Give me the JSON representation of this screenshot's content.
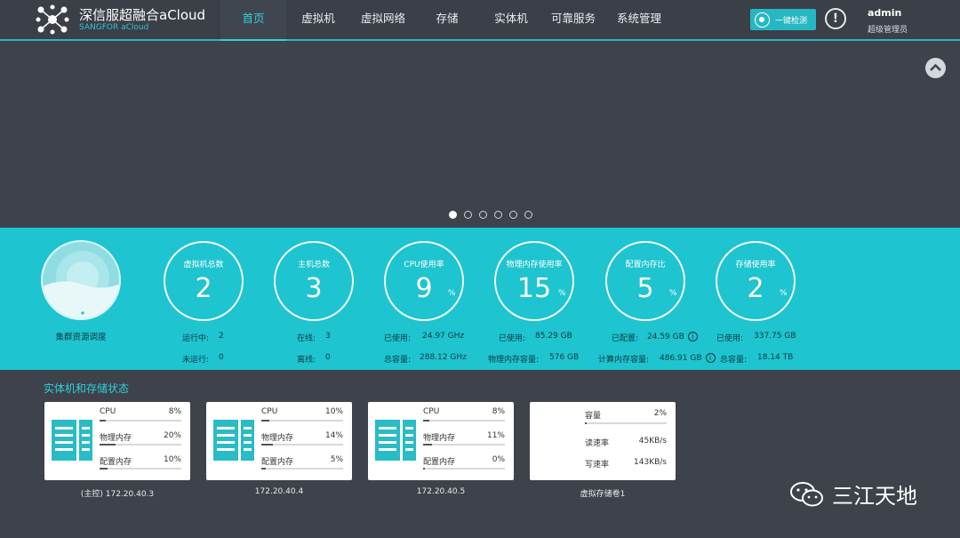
{
  "header": {
    "brand": "深信服超融合aCloud",
    "brand_sub": "SANGFOR aCloud",
    "nav": [
      "首页",
      "虚拟机",
      "虚拟网络",
      "存储",
      "实体机",
      "可靠服务",
      "系统管理"
    ],
    "check_button": "一键检测",
    "alert": "!",
    "user_name": "admin",
    "user_role": "超级管理员"
  },
  "overview": {
    "cluster_label": "集群资源调度",
    "rings": [
      {
        "title": "虚拟机总数",
        "value": "2",
        "pct": ""
      },
      {
        "title": "主机总数",
        "value": "3",
        "pct": ""
      },
      {
        "title": "CPU使用率",
        "value": "9",
        "pct": "%"
      },
      {
        "title": "物理内存使用率",
        "value": "15",
        "pct": "%"
      },
      {
        "title": "配置内存比",
        "value": "5",
        "pct": "%"
      },
      {
        "title": "存储使用率",
        "value": "2",
        "pct": "%"
      }
    ],
    "stats": [
      [
        {
          "label": "运行中:",
          "value": "2"
        },
        {
          "label": "未运行:",
          "value": "0"
        }
      ],
      [
        {
          "label": "在线:",
          "value": "3"
        },
        {
          "label": "离线:",
          "value": "0"
        }
      ],
      [
        {
          "label": "已使用:",
          "value": "24.97 GHz"
        },
        {
          "label": "总容量:",
          "value": "288.12 GHz"
        }
      ],
      [
        {
          "label": "已使用:",
          "value": "85.29 GB"
        },
        {
          "label": "物理内存容量:",
          "value": "576 GB"
        }
      ],
      [
        {
          "label": "已配置:",
          "value": "24.59 GB"
        },
        {
          "label": "计算内存容量:",
          "value": "486.91 GB"
        }
      ],
      [
        {
          "label": "已使用:",
          "value": "337.75 GB"
        },
        {
          "label": "总容量:",
          "value": "18.14 TB"
        }
      ]
    ]
  },
  "section_title": "实体机和存储状态",
  "hosts": [
    {
      "caption": "(主控) 172.20.40.3",
      "rows": [
        {
          "label": "CPU",
          "value": "8%",
          "fill": 0.08
        },
        {
          "label": "物理内存",
          "value": "20%",
          "fill": 0.2
        },
        {
          "label": "配置内存",
          "value": "10%",
          "fill": 0.1
        }
      ]
    },
    {
      "caption": "172.20.40.4",
      "rows": [
        {
          "label": "CPU",
          "value": "10%",
          "fill": 0.1
        },
        {
          "label": "物理内存",
          "value": "14%",
          "fill": 0.14
        },
        {
          "label": "配置内存",
          "value": "5%",
          "fill": 0.05
        }
      ]
    },
    {
      "caption": "172.20.40.5",
      "rows": [
        {
          "label": "CPU",
          "value": "8%",
          "fill": 0.08
        },
        {
          "label": "物理内存",
          "value": "11%",
          "fill": 0.11
        },
        {
          "label": "配置内存",
          "value": "0%",
          "fill": 0.0
        }
      ]
    }
  ],
  "storage": {
    "caption": "虚拟存储卷1",
    "capacity_label": "容量",
    "capacity_value": "2%",
    "capacity_fill": 0.02,
    "read_label": "读速率",
    "read_value": "45KB/s",
    "write_label": "写速率",
    "write_value": "143KB/s"
  },
  "watermark": "三江天地",
  "colors": {
    "teal": "#1ec4cf",
    "accent": "#2fd0db",
    "bg": "#3d424b"
  }
}
